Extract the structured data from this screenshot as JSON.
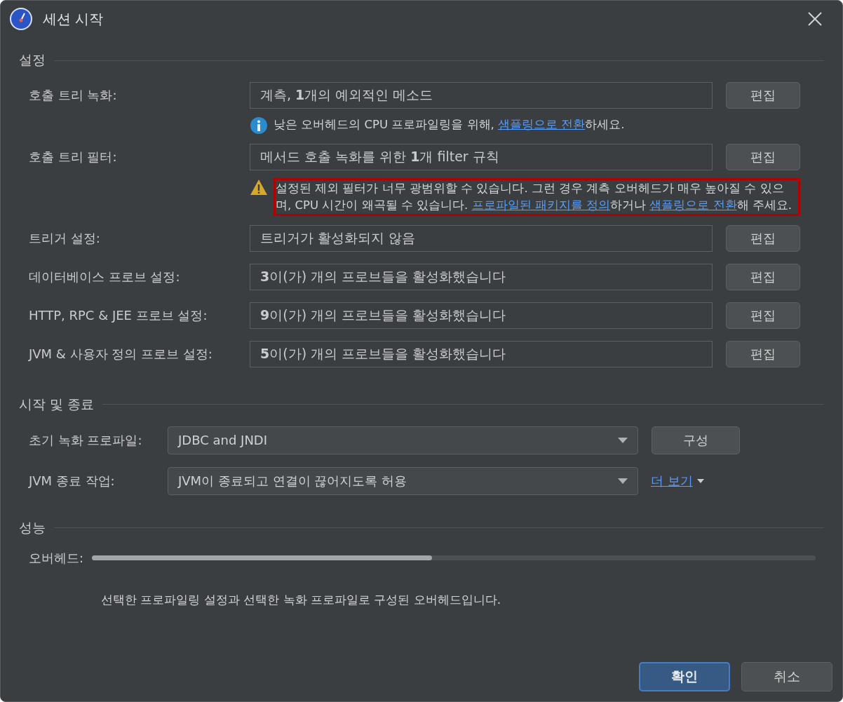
{
  "window": {
    "title": "세션 시작"
  },
  "settings": {
    "heading": "설정",
    "rows": [
      {
        "label": "호출 트리 녹화:",
        "value": "계측, **1**개의 예외적인 메소드",
        "button": "편집",
        "note": {
          "kind": "info",
          "highlighted": false,
          "parts": [
            {
              "kind": "text",
              "text": "낮은 오버헤드의 CPU 프로파일링을 위해, "
            },
            {
              "kind": "link",
              "text": "샘플링으로 전환"
            },
            {
              "kind": "text",
              "text": "하세요."
            }
          ]
        }
      },
      {
        "label": "호출 트리 필터:",
        "value": "메서드 호출 녹화를 위한 **1**개 filter 규칙",
        "button": "편집",
        "note": {
          "kind": "warning",
          "highlighted": true,
          "parts": [
            {
              "kind": "text",
              "text": "설정된 제외 필터가 너무 광범위할 수 있습니다. 그런 경우 계측 오버헤드가 매우 높아질 수 있으며, CPU 시간이 왜곡될 수 있습니다. "
            },
            {
              "kind": "link",
              "text": "프로파일된 패키지를 정의"
            },
            {
              "kind": "text",
              "text": "하거나 "
            },
            {
              "kind": "link",
              "text": "샘플링으로 전환"
            },
            {
              "kind": "text",
              "text": "해 주세요."
            }
          ]
        }
      },
      {
        "label": "트리거 설정:",
        "value": "트리거가 활성화되지 않음",
        "button": "편집"
      },
      {
        "label": "데이터베이스 프로브 설정:",
        "value": "**3**이(가) 개의 프로브들을 활성화했습니다",
        "button": "편집"
      },
      {
        "label": "HTTP, RPC & JEE 프로브 설정:",
        "value": "**9**이(가) 개의 프로브들을 활성화했습니다",
        "button": "편집"
      },
      {
        "label": "JVM & 사용자 정의 프로브 설정:",
        "value": "**5**이(가) 개의 프로브들을 활성화했습니다",
        "button": "편집"
      }
    ]
  },
  "startup": {
    "heading": "시작 및 종료",
    "rows": [
      {
        "label": "초기 녹화 프로파일:",
        "value": "JDBC and JNDI",
        "kind": "button",
        "button": "구성"
      },
      {
        "label": "JVM 종료 작업:",
        "value": "JVM이 종료되고 연결이 끊어지도록 허용",
        "kind": "link",
        "link": "더 보기"
      }
    ]
  },
  "performance": {
    "heading": "성능",
    "label": "오버헤드:",
    "level": 0.47,
    "description": "선택한 프로파일링 설정과 선택한 녹화 프로파일로 구성된 오버헤드입니다."
  },
  "buttons": [
    {
      "label": "확인",
      "primary": true
    },
    {
      "label": "취소",
      "primary": false
    }
  ]
}
